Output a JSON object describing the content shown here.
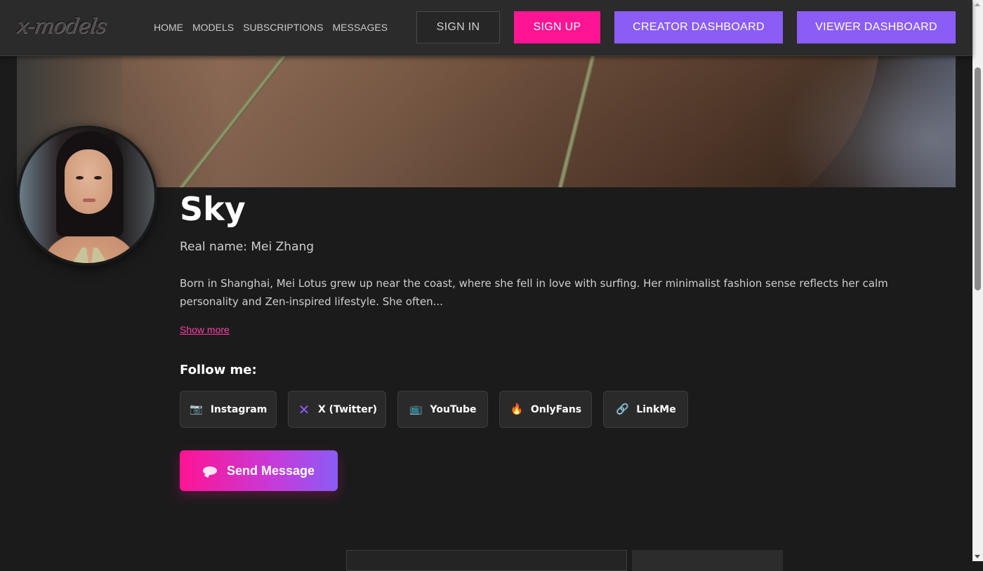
{
  "header": {
    "logo_text": "x-models",
    "nav": [
      "HOME",
      "MODELS",
      "SUBSCRIPTIONS",
      "MESSAGES"
    ],
    "sign_in": "SIGN IN",
    "sign_up": "SIGN UP",
    "creator_dashboard": "CREATOR DASHBOARD",
    "viewer_dashboard": "VIEWER DASHBOARD"
  },
  "profile": {
    "name": "Sky",
    "real_name": "Real name: Mei Zhang",
    "bio": "Born in Shanghai, Mei Lotus grew up near the coast, where she fell in love with surfing. Her minimalist fashion sense reflects her calm personality and Zen-inspired lifestyle. She often...",
    "show_more": "Show more",
    "follow_heading": "Follow me:",
    "socials": [
      {
        "label": "Instagram",
        "icon": "camera-icon"
      },
      {
        "label": "X (Twitter)",
        "icon": "x-icon"
      },
      {
        "label": "YouTube",
        "icon": "tv-icon"
      },
      {
        "label": "OnlyFans",
        "icon": "fire-icon"
      },
      {
        "label": "LinkMe",
        "icon": "link-icon"
      }
    ],
    "send_message": "Send Message"
  },
  "colors": {
    "accent_pink": "#ff1493",
    "accent_purple": "#8b5cf6",
    "background": "#1c1b1c",
    "header": "#2b2b2b"
  }
}
